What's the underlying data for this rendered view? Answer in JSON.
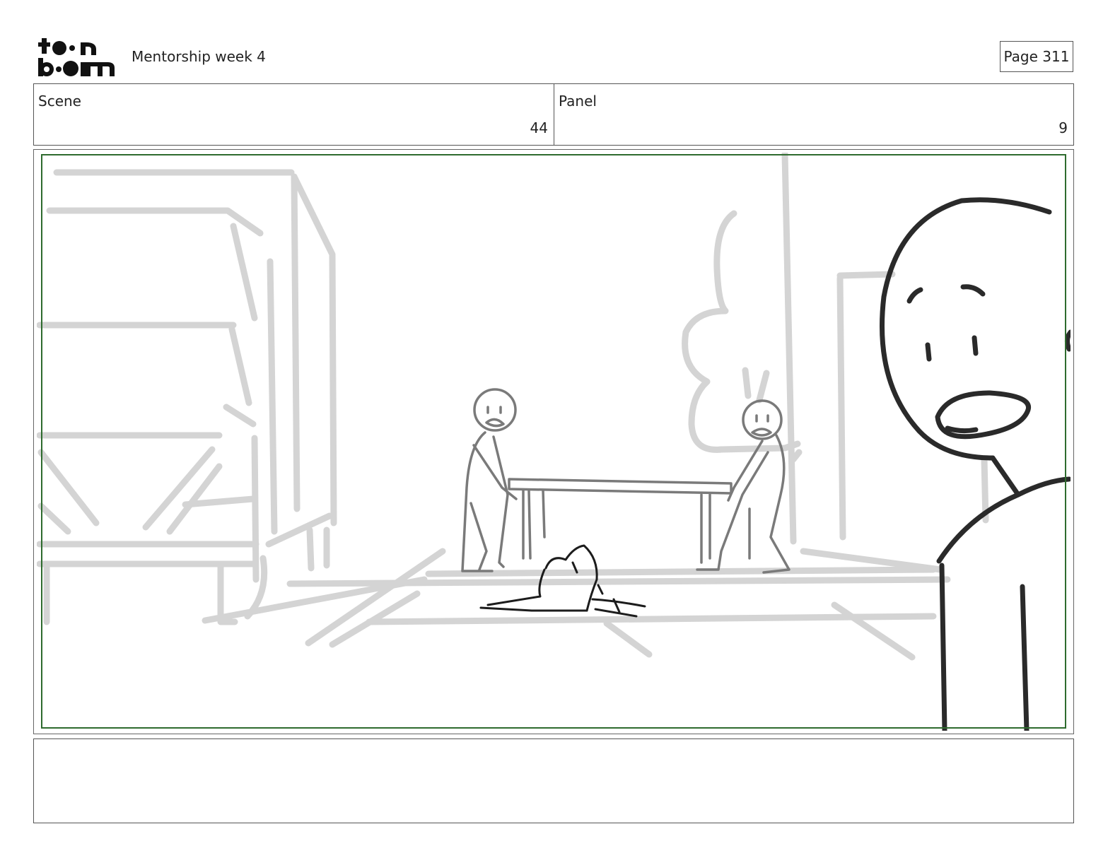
{
  "header": {
    "logo_alt": "toon boom",
    "document_title": "Mentorship week 4",
    "page_label": "Page 311"
  },
  "info": {
    "scene_label": "Scene",
    "scene_value": "44",
    "panel_label": "Panel",
    "panel_value": "9"
  },
  "notes": {
    "text": ""
  },
  "colors": {
    "frame_border": "#2e6b2e",
    "sketch_background": "#d4d4d4",
    "sketch_midground": "#7a7a7a",
    "sketch_foreground": "#2a2a2a"
  }
}
